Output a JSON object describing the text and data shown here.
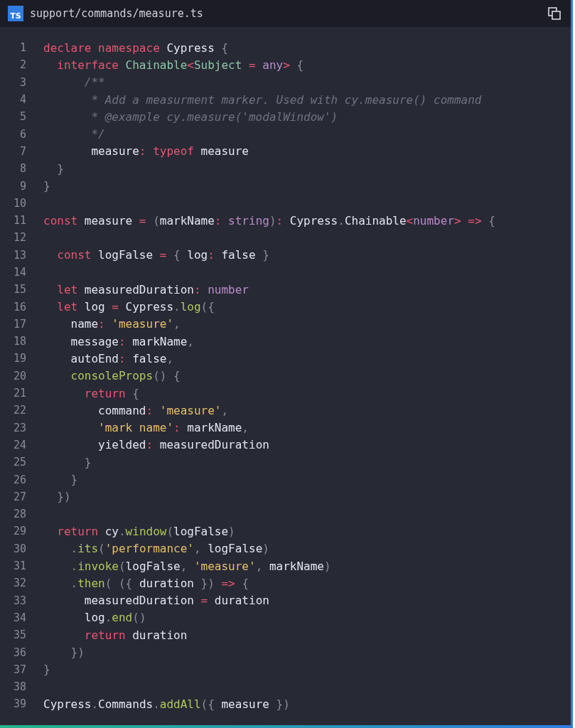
{
  "header": {
    "file_badge": "TS",
    "path": "support/commands/measure.ts"
  },
  "lines": [
    {
      "number": "1",
      "tokens": [
        {
          "kind": "kw",
          "text": "declare namespace "
        },
        {
          "kind": "tx",
          "text": "Cypress "
        },
        {
          "kind": "pn",
          "text": "{"
        }
      ]
    },
    {
      "number": "2",
      "tokens": [
        {
          "kind": "kw",
          "text": "  interface "
        },
        {
          "kind": "type",
          "text": "Chainable"
        },
        {
          "kind": "op",
          "text": "<"
        },
        {
          "kind": "type",
          "text": "Subject"
        },
        {
          "kind": "op",
          "text": " = "
        },
        {
          "kind": "bi",
          "text": "any"
        },
        {
          "kind": "op",
          "text": "> "
        },
        {
          "kind": "pn",
          "text": "{"
        }
      ]
    },
    {
      "number": "3",
      "tokens": [
        {
          "kind": "cm",
          "text": "      /**"
        }
      ]
    },
    {
      "number": "4",
      "tokens": [
        {
          "kind": "cm",
          "text": "       * Add a measurment marker. Used with cy.measure() command"
        }
      ]
    },
    {
      "number": "5",
      "tokens": [
        {
          "kind": "cm",
          "text": "       * @example cy.measure('modalWindow')"
        }
      ]
    },
    {
      "number": "6",
      "tokens": [
        {
          "kind": "cm",
          "text": "       */"
        }
      ]
    },
    {
      "number": "7",
      "tokens": [
        {
          "kind": "tx",
          "text": "       measure"
        },
        {
          "kind": "op",
          "text": ": "
        },
        {
          "kind": "kw",
          "text": "typeof "
        },
        {
          "kind": "tx",
          "text": "measure"
        }
      ]
    },
    {
      "number": "8",
      "tokens": [
        {
          "kind": "pn",
          "text": "  }"
        }
      ]
    },
    {
      "number": "9",
      "tokens": [
        {
          "kind": "pn",
          "text": "}"
        }
      ]
    },
    {
      "number": "10"
    },
    {
      "number": "11",
      "tokens": [
        {
          "kind": "kw",
          "text": "const "
        },
        {
          "kind": "tx",
          "text": "measure "
        },
        {
          "kind": "op",
          "text": "= "
        },
        {
          "kind": "pn",
          "text": "("
        },
        {
          "kind": "tx",
          "text": "markName"
        },
        {
          "kind": "op",
          "text": ": "
        },
        {
          "kind": "bi",
          "text": "string"
        },
        {
          "kind": "pn",
          "text": ")"
        },
        {
          "kind": "op",
          "text": ": "
        },
        {
          "kind": "tx",
          "text": "Cypress"
        },
        {
          "kind": "pn",
          "text": "."
        },
        {
          "kind": "tx",
          "text": "Chainable"
        },
        {
          "kind": "op",
          "text": "<"
        },
        {
          "kind": "bi",
          "text": "number"
        },
        {
          "kind": "op",
          "text": "> => "
        },
        {
          "kind": "pn",
          "text": "{"
        }
      ]
    },
    {
      "number": "12"
    },
    {
      "number": "13",
      "tokens": [
        {
          "kind": "kw",
          "text": "  const "
        },
        {
          "kind": "tx",
          "text": "logFalse "
        },
        {
          "kind": "op",
          "text": "= "
        },
        {
          "kind": "pn",
          "text": "{ "
        },
        {
          "kind": "tx",
          "text": "log"
        },
        {
          "kind": "op",
          "text": ": "
        },
        {
          "kind": "tx",
          "text": "false "
        },
        {
          "kind": "pn",
          "text": "}"
        }
      ]
    },
    {
      "number": "14"
    },
    {
      "number": "15",
      "tokens": [
        {
          "kind": "kw",
          "text": "  let "
        },
        {
          "kind": "tx",
          "text": "measuredDuration"
        },
        {
          "kind": "op",
          "text": ": "
        },
        {
          "kind": "bi",
          "text": "number"
        }
      ]
    },
    {
      "number": "16",
      "tokens": [
        {
          "kind": "kw",
          "text": "  let "
        },
        {
          "kind": "tx",
          "text": "log "
        },
        {
          "kind": "op",
          "text": "= "
        },
        {
          "kind": "tx",
          "text": "Cypress"
        },
        {
          "kind": "pn",
          "text": "."
        },
        {
          "kind": "fn",
          "text": "log"
        },
        {
          "kind": "pn",
          "text": "({"
        }
      ]
    },
    {
      "number": "17",
      "tokens": [
        {
          "kind": "tx",
          "text": "    name"
        },
        {
          "kind": "op",
          "text": ": "
        },
        {
          "kind": "str",
          "text": "'measure'"
        },
        {
          "kind": "pn",
          "text": ","
        }
      ]
    },
    {
      "number": "18",
      "tokens": [
        {
          "kind": "tx",
          "text": "    message"
        },
        {
          "kind": "op",
          "text": ": "
        },
        {
          "kind": "tx",
          "text": "markName"
        },
        {
          "kind": "pn",
          "text": ","
        }
      ]
    },
    {
      "number": "19",
      "tokens": [
        {
          "kind": "tx",
          "text": "    autoEnd"
        },
        {
          "kind": "op",
          "text": ": "
        },
        {
          "kind": "tx",
          "text": "false"
        },
        {
          "kind": "pn",
          "text": ","
        }
      ]
    },
    {
      "number": "20",
      "tokens": [
        {
          "kind": "fn",
          "text": "    consoleProps"
        },
        {
          "kind": "pn",
          "text": "() {"
        }
      ]
    },
    {
      "number": "21",
      "tokens": [
        {
          "kind": "kw",
          "text": "      return "
        },
        {
          "kind": "pn",
          "text": "{"
        }
      ]
    },
    {
      "number": "22",
      "tokens": [
        {
          "kind": "tx",
          "text": "        command"
        },
        {
          "kind": "op",
          "text": ": "
        },
        {
          "kind": "str",
          "text": "'measure'"
        },
        {
          "kind": "pn",
          "text": ","
        }
      ]
    },
    {
      "number": "23",
      "tokens": [
        {
          "kind": "str",
          "text": "        'mark name'"
        },
        {
          "kind": "op",
          "text": ": "
        },
        {
          "kind": "tx",
          "text": "markName"
        },
        {
          "kind": "pn",
          "text": ","
        }
      ]
    },
    {
      "number": "24",
      "tokens": [
        {
          "kind": "tx",
          "text": "        yielded"
        },
        {
          "kind": "op",
          "text": ": "
        },
        {
          "kind": "tx",
          "text": "measuredDuration"
        }
      ]
    },
    {
      "number": "25",
      "tokens": [
        {
          "kind": "pn",
          "text": "      }"
        }
      ]
    },
    {
      "number": "26",
      "tokens": [
        {
          "kind": "pn",
          "text": "    }"
        }
      ]
    },
    {
      "number": "27",
      "tokens": [
        {
          "kind": "pn",
          "text": "  })"
        }
      ]
    },
    {
      "number": "28"
    },
    {
      "number": "29",
      "tokens": [
        {
          "kind": "kw",
          "text": "  return "
        },
        {
          "kind": "tx",
          "text": "cy"
        },
        {
          "kind": "pn",
          "text": "."
        },
        {
          "kind": "fn",
          "text": "window"
        },
        {
          "kind": "pn",
          "text": "("
        },
        {
          "kind": "tx",
          "text": "logFalse"
        },
        {
          "kind": "pn",
          "text": ")"
        }
      ]
    },
    {
      "number": "30",
      "tokens": [
        {
          "kind": "pn",
          "text": "    ."
        },
        {
          "kind": "fn",
          "text": "its"
        },
        {
          "kind": "pn",
          "text": "("
        },
        {
          "kind": "str",
          "text": "'performance'"
        },
        {
          "kind": "pn",
          "text": ", "
        },
        {
          "kind": "tx",
          "text": "logFalse"
        },
        {
          "kind": "pn",
          "text": ")"
        }
      ]
    },
    {
      "number": "31",
      "tokens": [
        {
          "kind": "pn",
          "text": "    ."
        },
        {
          "kind": "fn",
          "text": "invoke"
        },
        {
          "kind": "pn",
          "text": "("
        },
        {
          "kind": "tx",
          "text": "logFalse"
        },
        {
          "kind": "pn",
          "text": ", "
        },
        {
          "kind": "str",
          "text": "'measure'"
        },
        {
          "kind": "pn",
          "text": ", "
        },
        {
          "kind": "tx",
          "text": "markName"
        },
        {
          "kind": "pn",
          "text": ")"
        }
      ]
    },
    {
      "number": "32",
      "tokens": [
        {
          "kind": "pn",
          "text": "    ."
        },
        {
          "kind": "fn",
          "text": "then"
        },
        {
          "kind": "pn",
          "text": "( ({ "
        },
        {
          "kind": "tx",
          "text": "duration "
        },
        {
          "kind": "pn",
          "text": "}) "
        },
        {
          "kind": "op",
          "text": "=> "
        },
        {
          "kind": "pn",
          "text": "{"
        }
      ]
    },
    {
      "number": "33",
      "tokens": [
        {
          "kind": "tx",
          "text": "      measuredDuration "
        },
        {
          "kind": "op",
          "text": "= "
        },
        {
          "kind": "tx",
          "text": "duration"
        }
      ]
    },
    {
      "number": "34",
      "tokens": [
        {
          "kind": "tx",
          "text": "      log"
        },
        {
          "kind": "pn",
          "text": "."
        },
        {
          "kind": "fn",
          "text": "end"
        },
        {
          "kind": "pn",
          "text": "()"
        }
      ]
    },
    {
      "number": "35",
      "tokens": [
        {
          "kind": "kw",
          "text": "      return "
        },
        {
          "kind": "tx",
          "text": "duration"
        }
      ]
    },
    {
      "number": "36",
      "tokens": [
        {
          "kind": "pn",
          "text": "    })"
        }
      ]
    },
    {
      "number": "37",
      "tokens": [
        {
          "kind": "pn",
          "text": "}"
        }
      ]
    },
    {
      "number": "38"
    },
    {
      "number": "39",
      "tokens": [
        {
          "kind": "tx",
          "text": "Cypress"
        },
        {
          "kind": "pn",
          "text": "."
        },
        {
          "kind": "tx",
          "text": "Commands"
        },
        {
          "kind": "pn",
          "text": "."
        },
        {
          "kind": "fn",
          "text": "addAll"
        },
        {
          "kind": "pn",
          "text": "({ "
        },
        {
          "kind": "tx",
          "text": "measure "
        },
        {
          "kind": "pn",
          "text": "})"
        }
      ]
    }
  ]
}
